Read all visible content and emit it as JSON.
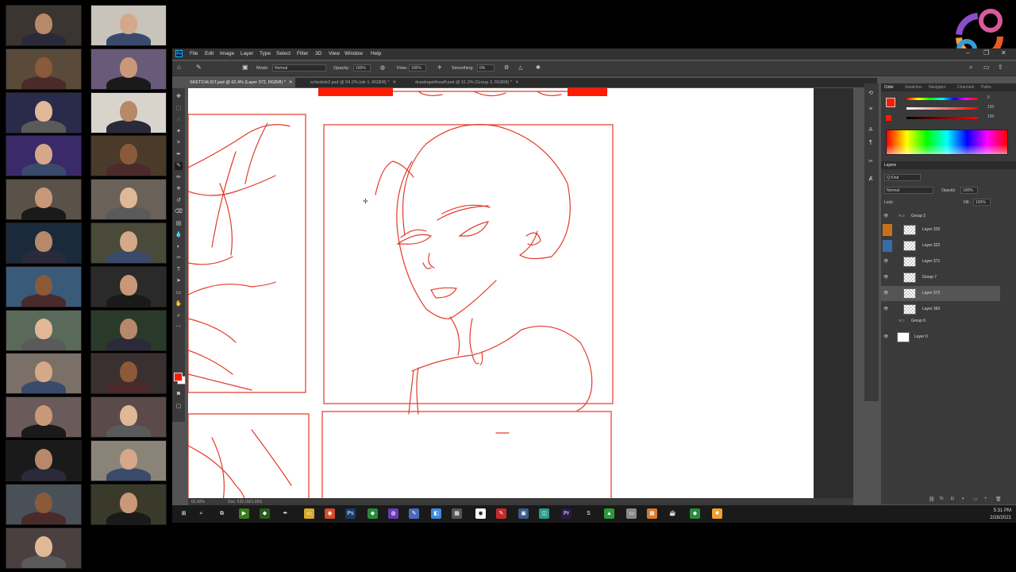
{
  "photoshop": {
    "menu": [
      "File",
      "Edit",
      "Image",
      "Layer",
      "Type",
      "Select",
      "Filter",
      "3D",
      "View",
      "Window",
      "Help"
    ],
    "options": {
      "mode_label": "Mode:",
      "mode_value": "Normal",
      "opacity_label": "Opacity:",
      "opacity_value": "100%",
      "flow_label": "Flow:",
      "flow_value": "100%",
      "smoothing_label": "Smoothing:",
      "smoothing_value": "0%"
    },
    "doc_tabs": [
      {
        "label": "SKETCHLIST.psd @ 62.4% (Layer 372, RGB/8) *",
        "active": true
      },
      {
        "label": "schedule2.psd @ 54.2% (wk 1, RGB/8) *",
        "active": false
      },
      {
        "label": "drawingwithwaff.psd @ 51.2% (Group 3, RGB/8) *",
        "active": false
      }
    ],
    "status": {
      "zoom": "62.42%",
      "doc": "Doc: 533.1M/1.95G"
    },
    "color_panel": {
      "tabs": [
        "Color",
        "Swatches",
        "Navigator",
        "Channels",
        "Paths"
      ],
      "values": [
        "0",
        "100",
        "100"
      ],
      "foreground": "#ff1a00",
      "accent": "#ff1a00"
    },
    "layers_panel": {
      "tabs": [
        "Layers"
      ],
      "kind_label": "Q Kind",
      "blend": "Normal",
      "opacity_label": "Opacity:",
      "opacity_value": "100%",
      "lock_label": "Lock:",
      "fill_label": "Fill:",
      "fill_value": "100%",
      "layers": [
        {
          "name": "Group 3",
          "type": "group"
        },
        {
          "name": "Layer 325",
          "type": "layer"
        },
        {
          "name": "Layer 322",
          "type": "layer"
        },
        {
          "name": "Layer 371",
          "type": "layer"
        },
        {
          "name": "Group 7",
          "type": "layer"
        },
        {
          "name": "Layer 372",
          "type": "layer",
          "selected": true
        },
        {
          "name": "Layer 360",
          "type": "layer"
        },
        {
          "name": "Group 6",
          "type": "group"
        },
        {
          "name": "Layer 0",
          "type": "layer"
        }
      ]
    }
  },
  "taskbar": {
    "time": "5:31 PM",
    "date": "2/28/2021"
  }
}
